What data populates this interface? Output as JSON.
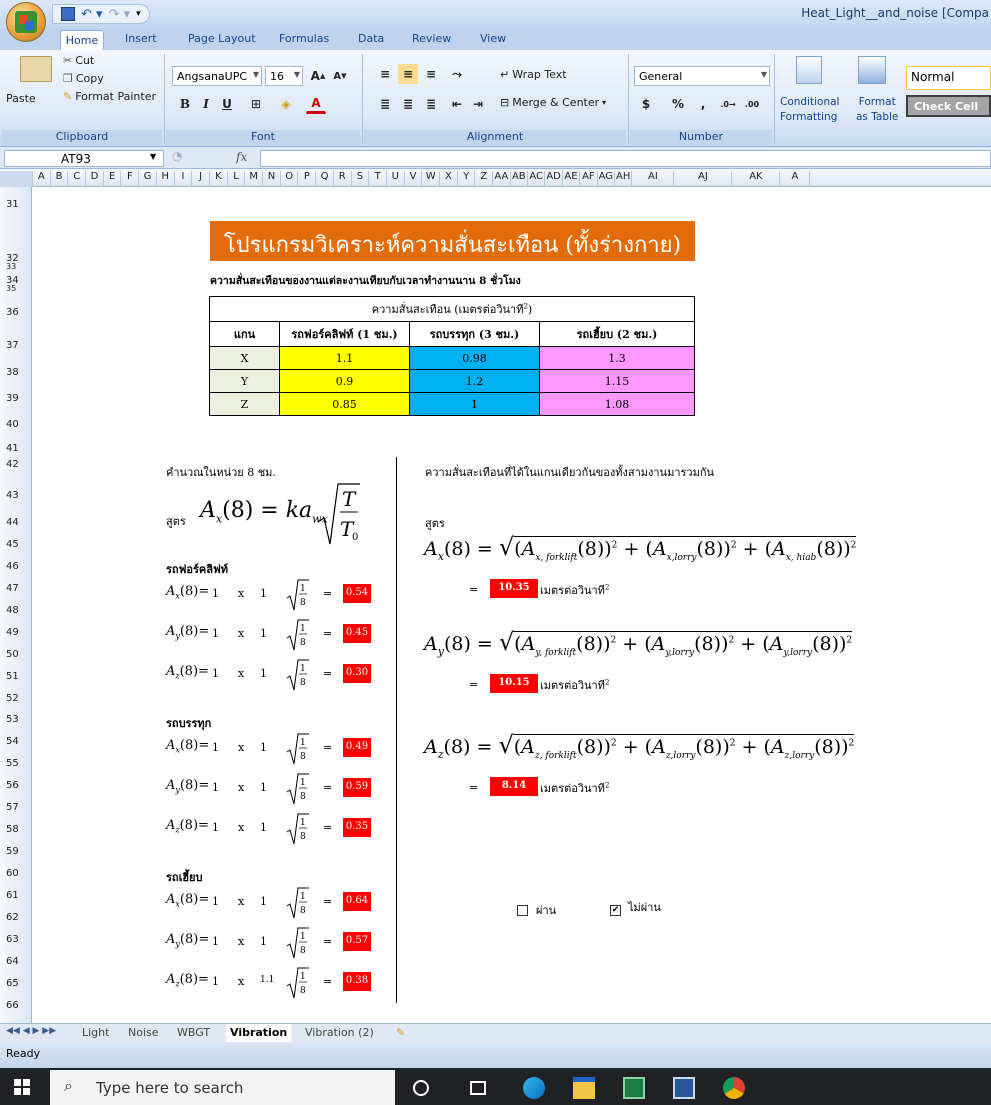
{
  "window": {
    "title": "Heat_Light__and_noise  [Compa"
  },
  "ribbon": {
    "tabs": [
      "Home",
      "Insert",
      "Page Layout",
      "Formulas",
      "Data",
      "Review",
      "View"
    ],
    "clipboard": {
      "paste": "Paste",
      "cut": "Cut",
      "copy": "Copy",
      "format_painter": "Format Painter",
      "label": "Clipboard"
    },
    "font": {
      "name": "AngsanaUPC",
      "size": "16",
      "label": "Font"
    },
    "alignment": {
      "wrap": "Wrap Text",
      "merge": "Merge & Center",
      "label": "Alignment"
    },
    "number": {
      "format": "General",
      "label": "Number"
    },
    "styles": {
      "conditional": "Conditional",
      "formatting": "Formatting",
      "format": "Format",
      "as_table": "as Table",
      "normal": "Normal",
      "check_cell": "Check Cell"
    }
  },
  "formula_bar": {
    "cell_ref": "AT93",
    "fx": "fx",
    "value": ""
  },
  "columns": [
    "A",
    "B",
    "C",
    "D",
    "E",
    "F",
    "G",
    "H",
    "I",
    "J",
    "K",
    "L",
    "M",
    "N",
    "O",
    "P",
    "Q",
    "R",
    "S",
    "T",
    "U",
    "V",
    "W",
    "X",
    "Y",
    "Z",
    "AA",
    "AB",
    "AC",
    "AD",
    "AE",
    "AF",
    "AG",
    "AH",
    "AI",
    "AJ",
    "AK",
    "A"
  ],
  "rows": [
    "31",
    "32",
    "33",
    "34",
    "35",
    "36",
    "37",
    "38",
    "39",
    "40",
    "41",
    "42",
    "43",
    "44",
    "45",
    "46",
    "47",
    "48",
    "49",
    "50",
    "51",
    "52",
    "53",
    "54",
    "55",
    "56",
    "57",
    "58",
    "59",
    "60",
    "61",
    "62",
    "63",
    "64",
    "65",
    "66"
  ],
  "sheet": {
    "title": "โปรแกรมวิเคราะห์ความสั่นสะเทือน (ทั้งร่างกาย)",
    "subtitle": "ความสั่นสะเทือนของงานแต่ละงานเทียบกับเวลาทำงานนาน 8 ชั่วโมง",
    "table": {
      "group_header": "ความสั่นสะเทือน (เมตรต่อวินาที",
      "group_header_sup": "2",
      "group_header_end": ")",
      "headers": [
        "แกน",
        "รถฟอร์คลิฟท์ (1 ชม.)",
        "รถบรรทุก (3 ชม.)",
        "รถเฮี้ยบ (2 ชม.)"
      ],
      "rows": [
        {
          "axis": "X",
          "forklift": "1.1",
          "lorry": "0.98",
          "hiab": "1.3"
        },
        {
          "axis": "Y",
          "forklift": "0.9",
          "lorry": "1.2",
          "hiab": "1.15"
        },
        {
          "axis": "Z",
          "forklift": "0.85",
          "lorry": "1",
          "hiab": "1.08"
        }
      ]
    },
    "left": {
      "heading": "คำนวณในหน่วย 8 ชม.",
      "formula_prefix": "สูตร",
      "groups": [
        {
          "name": "รถฟอร์คลิฟท์",
          "rows": [
            {
              "axis": "x",
              "k": "1",
              "a": "1",
              "result": "0.54"
            },
            {
              "axis": "y",
              "k": "1",
              "a": "1",
              "result": "0.45"
            },
            {
              "axis": "z",
              "k": "1",
              "a": "1",
              "result": "0.30"
            }
          ]
        },
        {
          "name": "รถบรรทุก",
          "rows": [
            {
              "axis": "x",
              "k": "1",
              "a": "1",
              "result": "0.49"
            },
            {
              "axis": "y",
              "k": "1",
              "a": "1",
              "result": "0.59"
            },
            {
              "axis": "z",
              "k": "1",
              "a": "1",
              "result": "0.35"
            }
          ]
        },
        {
          "name": "รถเฮี้ยบ",
          "rows": [
            {
              "axis": "x",
              "k": "1",
              "a": "1",
              "result": "0.64"
            },
            {
              "axis": "y",
              "k": "1",
              "a": "1",
              "result": "0.57"
            },
            {
              "axis": "z",
              "k": "1",
              "a": "1.1",
              "result": "0.38"
            }
          ]
        }
      ],
      "times_sign": "x",
      "sqrt_frac": "1/8"
    },
    "right": {
      "heading": "ความสั่นสะเทือนที่ได้ในแกนเดียวกันของทั้งสามงานมารวมกัน",
      "formula_prefix": "สูตร",
      "unit": "เมตรต่อวินาที",
      "unit_sup": "2",
      "results": [
        {
          "axis": "x",
          "sub1": "x, forklift",
          "sub2": "x,lorry",
          "sub3": "x, hiab",
          "value": "10.35"
        },
        {
          "axis": "y",
          "sub1": "y, forklift",
          "sub2": "y,lorry",
          "sub3": "y,lorry",
          "value": "10.15"
        },
        {
          "axis": "z",
          "sub1": "z, forklift",
          "sub2": "z,lorry",
          "sub3": "z,lorry",
          "value": "8.14"
        }
      ],
      "pass_label": "ผ่าน",
      "fail_label": "ไม่ผ่าน",
      "pass_checked": false,
      "fail_checked": true
    }
  },
  "sheet_tabs": [
    "Light",
    "Noise",
    "WBGT",
    "Vibration",
    "Vibration (2)"
  ],
  "active_sheet": "Vibration",
  "status": "Ready",
  "taskbar": {
    "search_placeholder": "Type here to search"
  }
}
